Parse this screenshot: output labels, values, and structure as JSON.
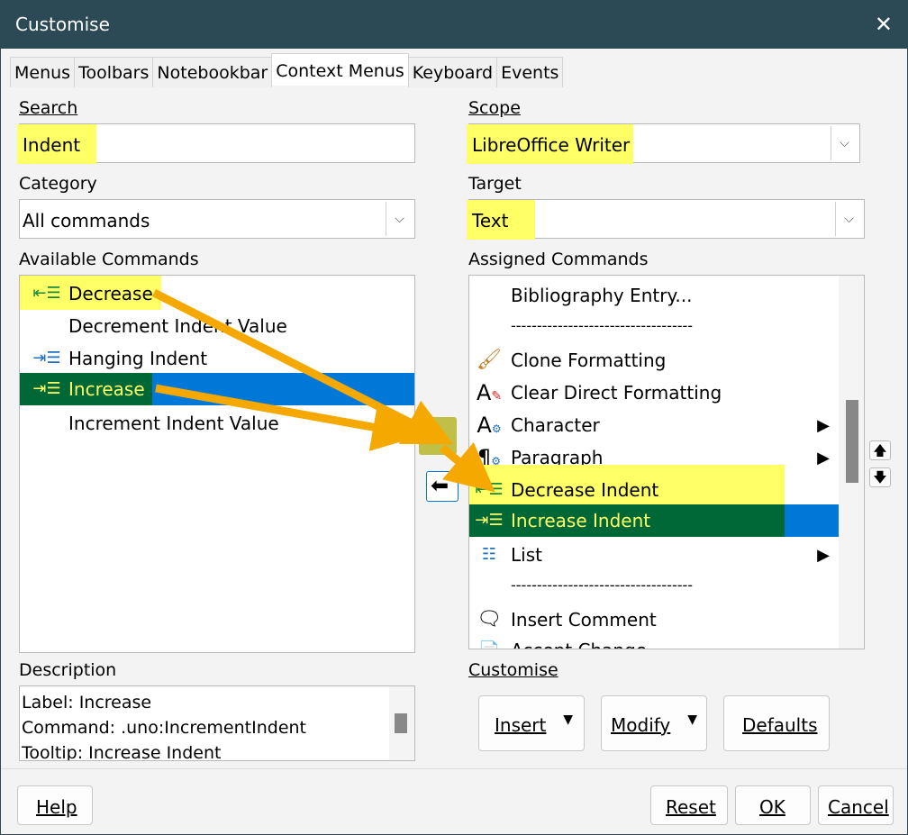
{
  "window": {
    "title": "Customise",
    "close_glyph": "✕"
  },
  "tabs": [
    "Menus",
    "Toolbars",
    "Notebookbar",
    "Context Menus",
    "Keyboard",
    "Events"
  ],
  "search": {
    "label": "Search",
    "value": "Indent"
  },
  "category": {
    "label": "Category",
    "value": "All commands"
  },
  "scope": {
    "label": "Scope",
    "value": "LibreOffice Writer"
  },
  "target": {
    "label": "Target",
    "value": "Text"
  },
  "available": {
    "label": "Available Commands",
    "items": [
      {
        "label": "Decrease",
        "icon": "decrease-indent-icon"
      },
      {
        "label": "Decrement Indent Value",
        "icon": ""
      },
      {
        "label": "Hanging Indent",
        "icon": "hanging-indent-icon"
      },
      {
        "label": "Increase",
        "icon": "increase-indent-icon"
      },
      {
        "label": "Increment Indent Value",
        "icon": ""
      }
    ]
  },
  "assigned": {
    "label": "Assigned Commands",
    "items": [
      {
        "label": "Bibliography Entry...",
        "icon": ""
      },
      {
        "label": "-----------------------------------",
        "icon": ""
      },
      {
        "label": "Clone Formatting",
        "icon": "clone-formatting-icon"
      },
      {
        "label": "Clear Direct Formatting",
        "icon": "clear-formatting-icon"
      },
      {
        "label": "Character",
        "icon": "character-icon",
        "submenu": true
      },
      {
        "label": "Paragraph",
        "icon": "paragraph-icon",
        "submenu": true
      },
      {
        "label": "Decrease Indent",
        "icon": "decrease-indent-icon"
      },
      {
        "label": "Increase Indent",
        "icon": "increase-indent-icon"
      },
      {
        "label": "List",
        "icon": "list-icon",
        "submenu": true
      },
      {
        "label": "-----------------------------------",
        "icon": ""
      },
      {
        "label": "Insert Comment",
        "icon": "comment-icon"
      },
      {
        "label": "Accept Change",
        "icon": "accept-change-icon"
      }
    ]
  },
  "description": {
    "label": "Description",
    "lines": [
      "Label: Increase",
      "Command: .uno:IncrementIndent",
      "Tooltip: Increase Indent"
    ]
  },
  "customise": {
    "label": "Customise",
    "insert": "Insert",
    "modify": "Modify",
    "defaults": "Defaults"
  },
  "footer": {
    "help": "Help",
    "reset": "Reset",
    "ok": "OK",
    "cancel": "Cancel"
  },
  "colors": {
    "titlebar": "#2b4a55",
    "highlight": "#ffff66",
    "selection": "#0078d7",
    "annotation_green": "#006837",
    "arrow": "#f5a800"
  }
}
